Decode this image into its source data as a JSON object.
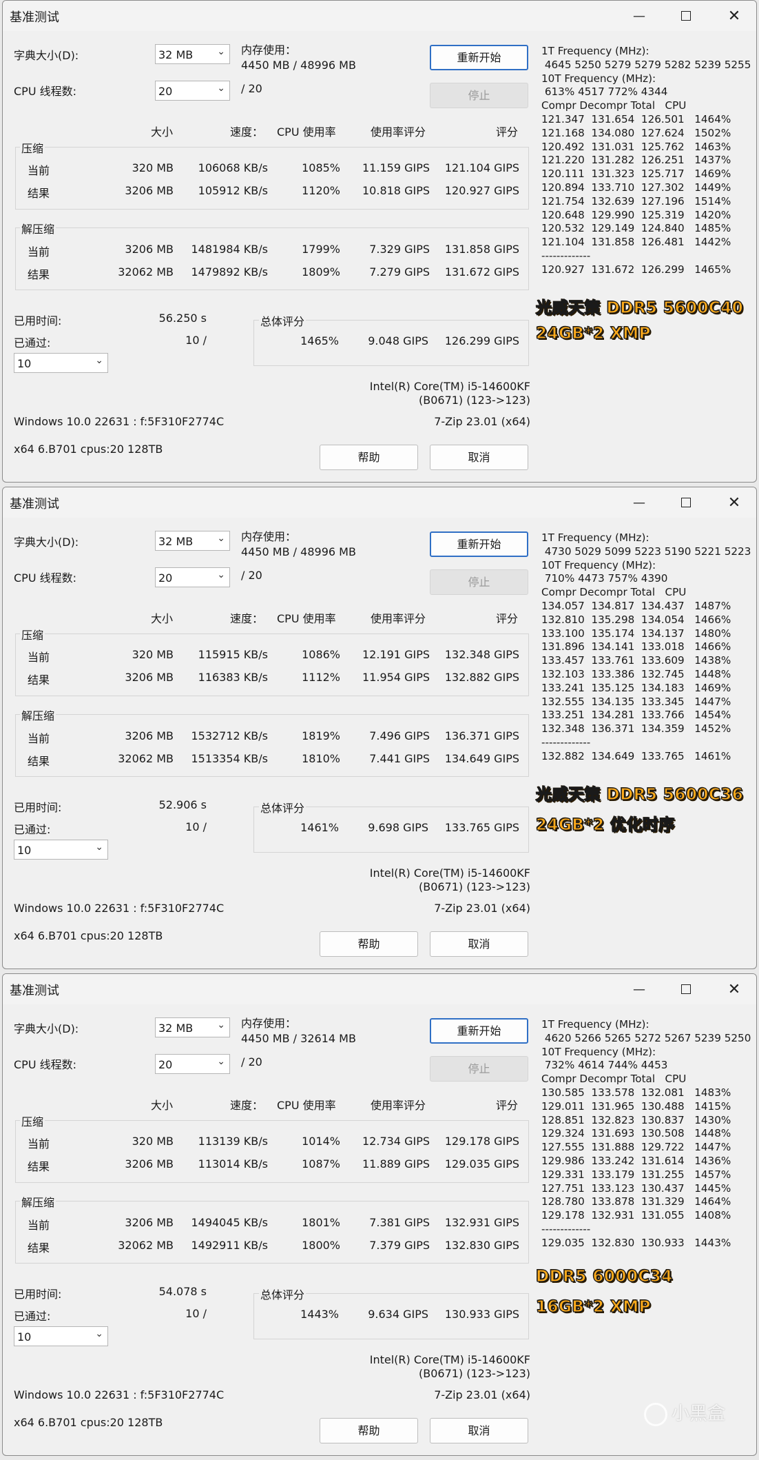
{
  "common": {
    "title": "基准测试",
    "minimize_icon": "minimize-icon",
    "maximize_icon": "maximize-icon",
    "close_icon": "close-icon",
    "dict_label": "字典大小(D):",
    "dict_value": "32 MB",
    "threads_label": "CPU 线程数:",
    "threads_value": "20",
    "threads_max": "/ 20",
    "mem_label": "内存使用：",
    "restart": "重新开始",
    "stop": "停止",
    "hdr_size": "大小",
    "hdr_speed": "速度：",
    "hdr_cpu": "CPU 使用率",
    "hdr_rating_usage": "使用率评分",
    "hdr_rating": "评分",
    "compress": "压缩",
    "decompress": "解压缩",
    "current": "当前",
    "result": "结果",
    "elapsed_label": "已用时间:",
    "passed_label": "已通过:",
    "passes_value": "10",
    "total_label": "总体评分",
    "cpu_name": "Intel(R) Core(TM) i5-14600KF",
    "cpu_id": "(B0671) (123->123)",
    "os": "Windows 10.0 22631 :  f:5F310F2774C",
    "zip": "7-Zip 23.01 (x64)",
    "arch": "x64 6.B701 cpus:20 128TB",
    "help": "帮助",
    "cancel": "取消"
  },
  "windows": [
    {
      "mem": "4450 MB / 48996 MB",
      "c_cur": [
        "320 MB",
        "106068 KB/s",
        "1085%",
        "11.159 GIPS",
        "121.104 GIPS"
      ],
      "c_res": [
        "3206 MB",
        "105912 KB/s",
        "1120%",
        "10.818 GIPS",
        "120.927 GIPS"
      ],
      "d_cur": [
        "3206 MB",
        "1481984 KB/s",
        "1799%",
        "7.329 GIPS",
        "131.858 GIPS"
      ],
      "d_res": [
        "32062 MB",
        "1479892 KB/s",
        "1809%",
        "7.279 GIPS",
        "131.672 GIPS"
      ],
      "elapsed": "56.250 s",
      "passed": "10 /",
      "total": [
        "1465%",
        "9.048 GIPS",
        "126.299 GIPS"
      ],
      "right_text": "1T Frequency (MHz):\n 4645 5250 5279 5279 5282 5239 5255\n10T Frequency (MHz):\n 613% 4517 772% 4344\nCompr Decompr Total   CPU\n121.347  131.654  126.501   1464%\n121.168  134.080  127.624   1502%\n120.492  131.031  125.762   1463%\n121.220  131.282  126.251   1437%\n120.111  131.323  125.717   1469%\n120.894  133.710  127.302   1449%\n121.754  132.639  127.196   1514%\n120.648  129.990  125.319   1420%\n120.532  129.149  124.840   1485%\n121.104  131.858  126.481   1442%\n-------------\n120.927  131.672  126.299   1465%",
      "overlay1": "光威天策 DDR5 5600C40",
      "overlay2": "24GB*2  XMP"
    },
    {
      "mem": "4450 MB / 48996 MB",
      "c_cur": [
        "320 MB",
        "115915 KB/s",
        "1086%",
        "12.191 GIPS",
        "132.348 GIPS"
      ],
      "c_res": [
        "3206 MB",
        "116383 KB/s",
        "1112%",
        "11.954 GIPS",
        "132.882 GIPS"
      ],
      "d_cur": [
        "3206 MB",
        "1532712 KB/s",
        "1819%",
        "7.496 GIPS",
        "136.371 GIPS"
      ],
      "d_res": [
        "32062 MB",
        "1513354 KB/s",
        "1810%",
        "7.441 GIPS",
        "134.649 GIPS"
      ],
      "elapsed": "52.906 s",
      "passed": "10 /",
      "total": [
        "1461%",
        "9.698 GIPS",
        "133.765 GIPS"
      ],
      "right_text": "1T Frequency (MHz):\n 4730 5029 5099 5223 5190 5221 5223\n10T Frequency (MHz):\n 710% 4473 757% 4390\nCompr Decompr Total   CPU\n134.057  134.817  134.437   1487%\n132.810  135.298  134.054   1466%\n133.100  135.174  134.137   1480%\n131.896  134.141  133.018   1466%\n133.457  133.761  133.609   1438%\n132.103  133.386  132.745   1448%\n133.241  135.125  134.183   1469%\n132.555  134.135  133.345   1447%\n133.251  134.281  133.766   1454%\n132.348  136.371  134.359   1452%\n-------------\n132.882  134.649  133.765   1461%",
      "overlay1": "光威天策 DDR5 5600C36",
      "overlay2": "24GB*2  优化时序"
    },
    {
      "mem": "4450 MB / 32614 MB",
      "c_cur": [
        "320 MB",
        "113139 KB/s",
        "1014%",
        "12.734 GIPS",
        "129.178 GIPS"
      ],
      "c_res": [
        "3206 MB",
        "113014 KB/s",
        "1087%",
        "11.889 GIPS",
        "129.035 GIPS"
      ],
      "d_cur": [
        "3206 MB",
        "1494045 KB/s",
        "1801%",
        "7.381 GIPS",
        "132.931 GIPS"
      ],
      "d_res": [
        "32062 MB",
        "1492911 KB/s",
        "1800%",
        "7.379 GIPS",
        "132.830 GIPS"
      ],
      "elapsed": "54.078 s",
      "passed": "10 /",
      "total": [
        "1443%",
        "9.634 GIPS",
        "130.933 GIPS"
      ],
      "right_text": "1T Frequency (MHz):\n 4620 5266 5265 5272 5267 5239 5250\n10T Frequency (MHz):\n 732% 4614 744% 4453\nCompr Decompr Total   CPU\n130.585  133.578  132.081   1483%\n129.011  131.965  130.488   1415%\n128.851  132.823  130.837   1430%\n129.324  131.693  130.508   1448%\n127.555  131.888  129.722   1447%\n129.986  133.242  131.614   1436%\n129.331  133.179  131.255   1457%\n127.751  133.123  130.437   1445%\n128.780  133.878  131.329   1464%\n129.178  132.931  131.055   1408%\n-------------\n129.035  132.830  130.933   1443%",
      "overlay1": "DDR5 6000C34",
      "overlay2": "16GB*2  XMP"
    }
  ],
  "watermark": "小黑盒"
}
